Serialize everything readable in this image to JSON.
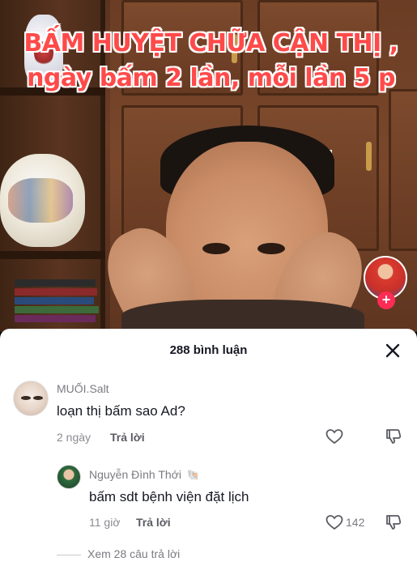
{
  "video": {
    "caption": "BẤM HUYỆT CHỮA CẬN THỊ , ngày bấm 2 lần, mỗi lần 5 p"
  },
  "comments_panel": {
    "title": "288 bình luận",
    "comments": [
      {
        "username": "MUỐI.Salt",
        "text": "loạn thị bấm sao Ad?",
        "time": "2 ngày",
        "reply_label": "Trả lời"
      }
    ],
    "reply": {
      "username": "Nguyễn Đình Thới",
      "badge": "🐚",
      "text": "bấm sdt bệnh viện đặt lịch",
      "time": "11 giờ",
      "reply_label": "Trả lời",
      "likes": "142"
    },
    "view_more": "Xem 28 câu trả lời"
  },
  "colors": {
    "caption_red": "#ff4a4a",
    "follow_pink": "#fe2c55"
  }
}
